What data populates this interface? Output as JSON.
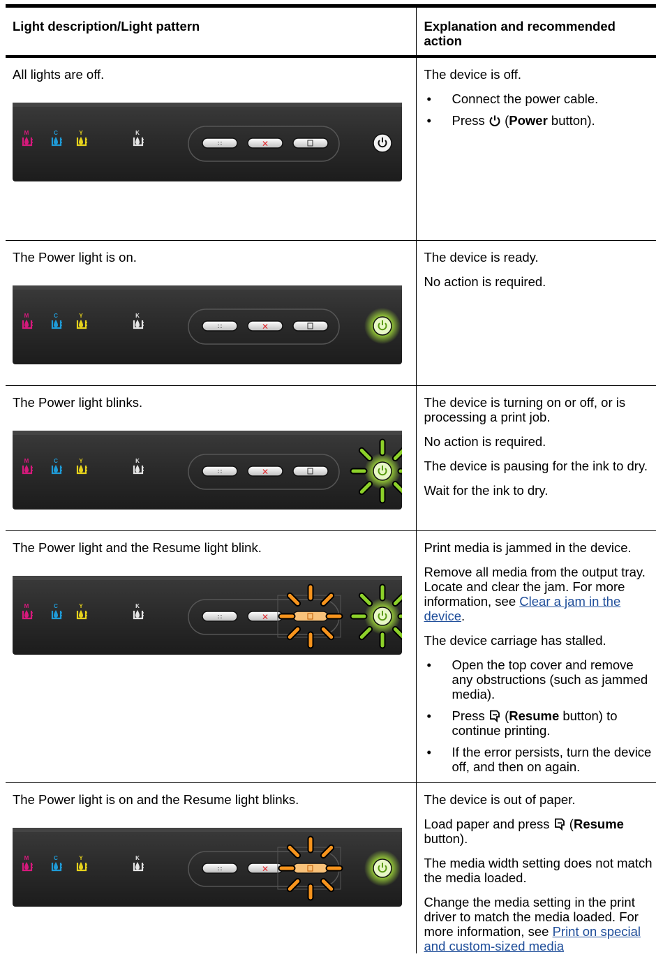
{
  "headers": {
    "col1": "Light description/Light pattern",
    "col2": "Explanation and recommended action"
  },
  "panel": {
    "cartridge_letters": [
      "M",
      "C",
      "Y",
      "K"
    ],
    "colors": {
      "magenta": "#d6197c",
      "cyan": "#1f9bd7",
      "yellow": "#e6d21c",
      "power_green": "#8dd12a",
      "resume_orange": "#f7941d",
      "cancel_red": "#e0262b",
      "panel_bg": "#2b2b2b"
    }
  },
  "rows": [
    {
      "description": "All lights are off.",
      "power": "off",
      "resume": "off",
      "explanation": {
        "p1": "The device is off.",
        "b1": "Connect the power cable.",
        "b2_pre": "Press ",
        "b2_bold": "Power",
        "b2_post": " button)."
      }
    },
    {
      "description": "The Power light is on.",
      "power": "on",
      "resume": "off",
      "explanation": {
        "p1": "The device is ready.",
        "p2": "No action is required."
      }
    },
    {
      "description": "The Power light blinks.",
      "power": "blink",
      "resume": "off",
      "explanation": {
        "p1": "The device is turning on or off, or is processing a print job.",
        "p2": "No action is required.",
        "p3": "The device is pausing for the ink to dry.",
        "p4": "Wait for the ink to dry."
      }
    },
    {
      "description": "The Power light and the Resume light blink.",
      "power": "blink",
      "resume": "blink",
      "explanation": {
        "p1": "Print media is jammed in the device.",
        "p2": "Remove all media from the output tray. Locate and clear the jam. For more information, see ",
        "p2_link": "Clear a jam in the device",
        "p3": "The device carriage has stalled.",
        "b1": "Open the top cover and remove any obstructions (such as jammed media).",
        "b2_pre": "Press ",
        "b2_bold": "Resume",
        "b2_post": " button) to continue printing.",
        "b3": "If the error persists, turn the device off, and then on again."
      }
    },
    {
      "description": "The Power light is on and the Resume light blinks.",
      "power": "on",
      "resume": "blink",
      "explanation": {
        "p1": "The device is out of paper.",
        "p2_pre": "Load paper and press ",
        "p2_bold": "Resume",
        "p2_post": " button).",
        "p3": "The media width setting does not match the media loaded.",
        "p4": "Change the media setting in the print driver to match the media loaded. For more information, see ",
        "p4_link": "Print on special and custom-sized media"
      }
    }
  ]
}
